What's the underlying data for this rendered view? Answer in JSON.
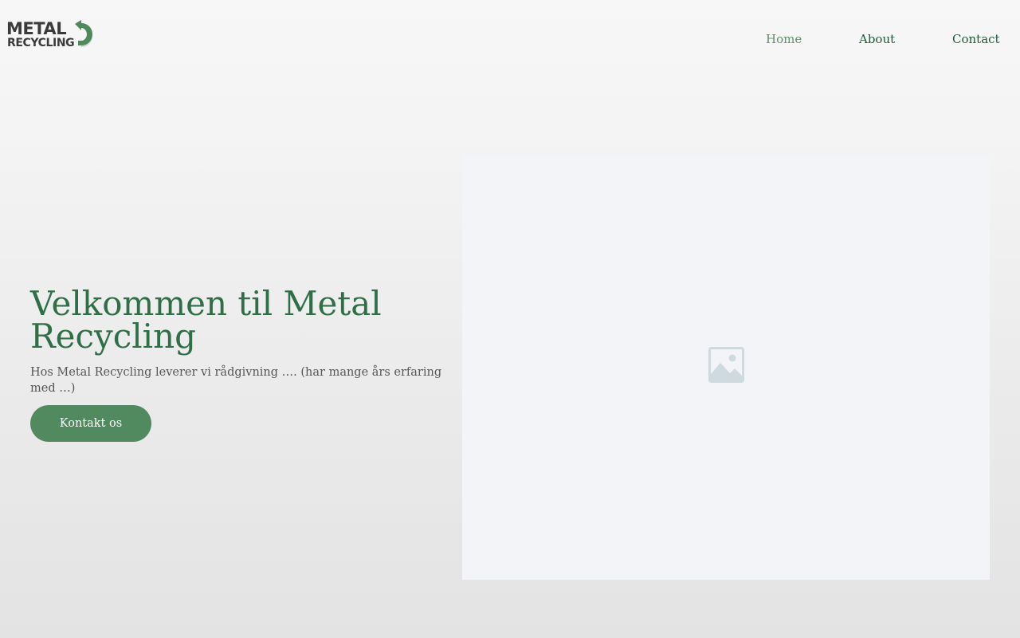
{
  "logo": {
    "line1": "METAL",
    "line2": "RECYCLING",
    "icon": "recycle-arrow-icon"
  },
  "nav": {
    "items": [
      {
        "label": "Home",
        "active": true
      },
      {
        "label": "About",
        "active": false
      },
      {
        "label": "Contact",
        "active": false
      }
    ]
  },
  "hero": {
    "title": "Velkommen til Metal Recycling",
    "subtitle": "Hos Metal Recycling leverer vi rådgivning …. (har mange års erfaring med …)",
    "cta_label": "Kontakt os"
  },
  "media": {
    "icon": "image-placeholder-icon"
  },
  "colors": {
    "brand_green": "#2f6f48",
    "button_green": "#528a60",
    "nav_active": "#5a9066",
    "nav_link": "#1f5b3b",
    "placeholder_bg": "#f3f4f8",
    "placeholder_icon": "#cfd9e0"
  }
}
